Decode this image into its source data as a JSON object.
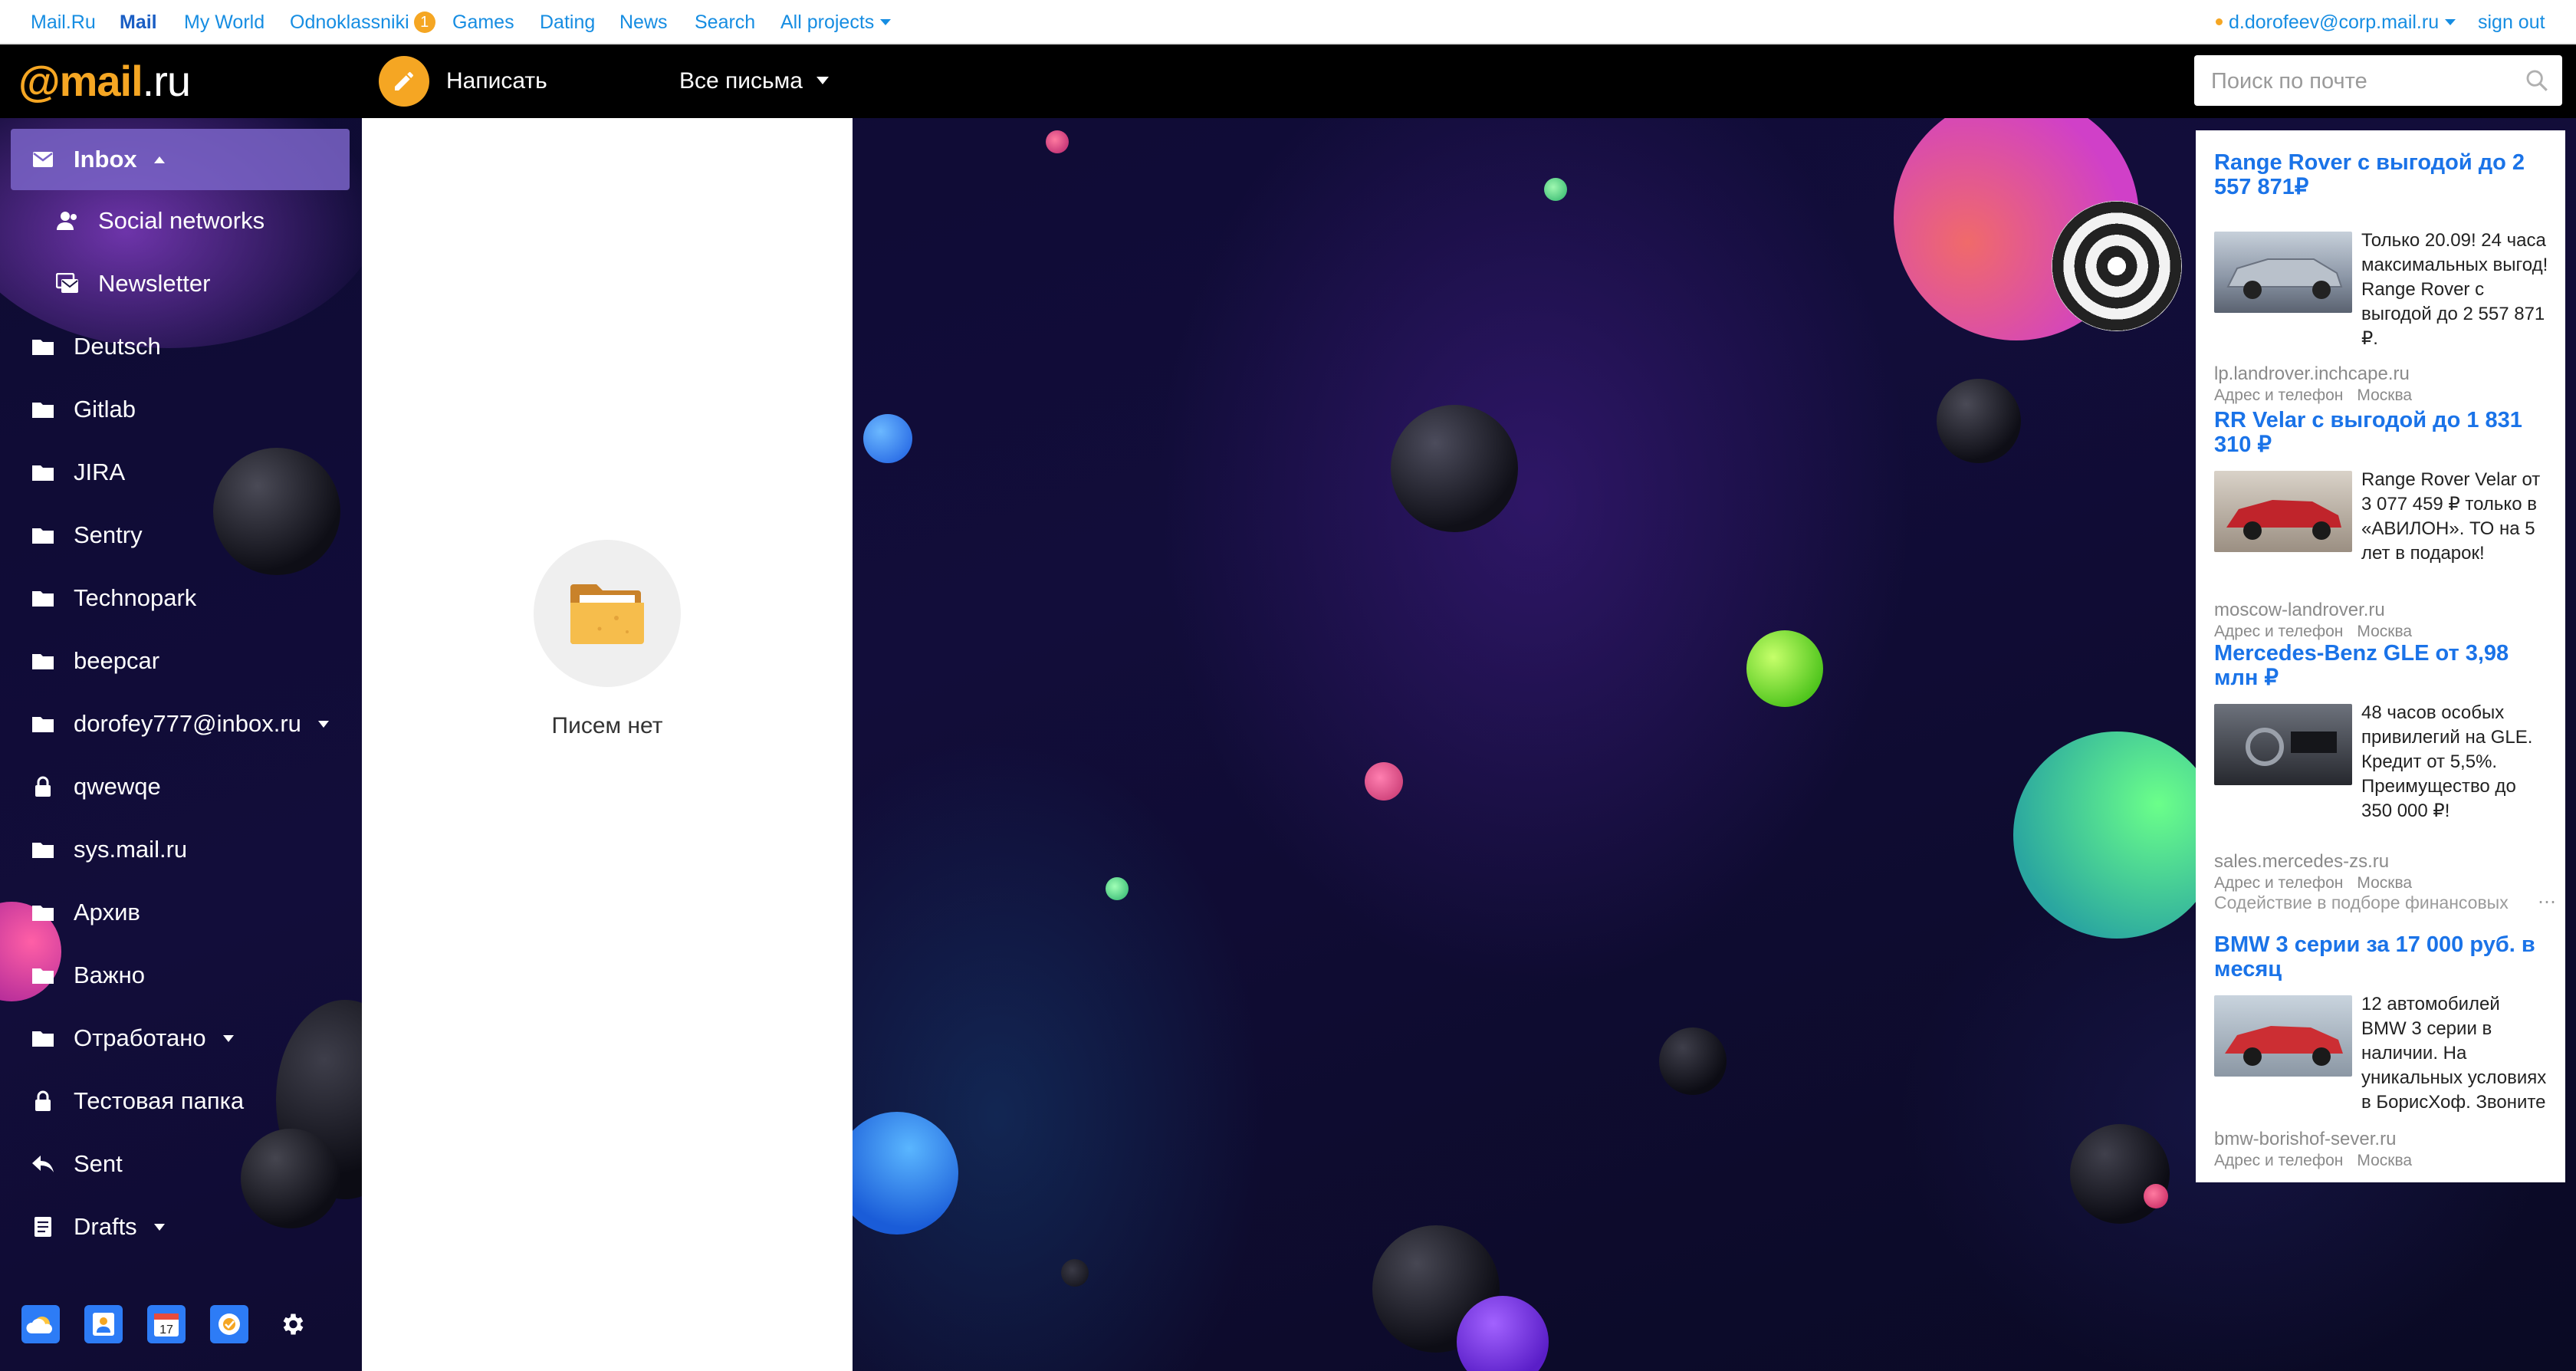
{
  "portal": {
    "links": [
      "Mail.Ru",
      "Mail",
      "My World",
      "Odnoklassniki",
      "Games",
      "Dating",
      "News",
      "Search",
      "All projects"
    ],
    "odnoklassniki_badge": "1",
    "user_email": "d.dorofeev@corp.mail.ru",
    "sign_out": "sign out"
  },
  "header": {
    "logo_at": "@",
    "logo_mail": "mail",
    "logo_ru": ".ru",
    "compose_label": "Написать",
    "filter_label": "Все письма",
    "search_placeholder": "Поиск по почте"
  },
  "sidebar": {
    "folders": [
      {
        "label": "Inbox",
        "icon": "inbox-icon"
      },
      {
        "label": "Social networks",
        "icon": "social-icon"
      },
      {
        "label": "Newsletter",
        "icon": "newsletter-icon"
      },
      {
        "label": "Deutsch",
        "icon": "folder-icon"
      },
      {
        "label": "Gitlab",
        "icon": "folder-icon"
      },
      {
        "label": "JIRA",
        "icon": "folder-icon"
      },
      {
        "label": "Sentry",
        "icon": "folder-icon"
      },
      {
        "label": "Technopark",
        "icon": "folder-icon"
      },
      {
        "label": "beepcar",
        "icon": "folder-icon"
      },
      {
        "label": "dorofey777@inbox.ru",
        "icon": "folder-icon"
      },
      {
        "label": "qwewqe",
        "icon": "lock-icon"
      },
      {
        "label": "sys.mail.ru",
        "icon": "folder-icon"
      },
      {
        "label": "Архив",
        "icon": "folder-icon"
      },
      {
        "label": "Важно",
        "icon": "folder-icon"
      },
      {
        "label": "Отработано",
        "icon": "folder-icon"
      },
      {
        "label": "Тестовая папка",
        "icon": "lock-icon"
      },
      {
        "label": "Sent",
        "icon": "sent-icon"
      },
      {
        "label": "Drafts",
        "icon": "drafts-icon"
      }
    ],
    "apps": [
      "cloud-icon",
      "contacts-icon",
      "calendar-icon",
      "todo-icon",
      "settings-icon"
    ],
    "calendar_day": "17"
  },
  "list": {
    "empty_text": "Писем нет"
  },
  "ads": {
    "items": [
      {
        "title": "Range Rover с выгодой до 2 557 871₽",
        "desc": "Только 20.09! 24 часа максимальных выгод! Range Rover с выгодой до 2 557 871 ₽.",
        "url": "lp.landrover.inchcape.ru",
        "meta_contacts": "Адрес и телефон",
        "meta_city": "Москва",
        "img_color": "#9aa6b6"
      },
      {
        "title": "RR Velar с выгодой до 1 831 310 ₽",
        "desc": "Range Rover Velar от 3 077 459 ₽ только в «АВИЛОН». ТО на 5 лет в подарок!",
        "url": "moscow-landrover.ru",
        "meta_contacts": "Адрес и телефон",
        "meta_city": "Москва",
        "img_color": "#b32a2a"
      },
      {
        "title": "Mercedes-Benz GLE от 3,98 млн ₽",
        "desc": "48 часов особых привилегий на GLE. Кредит от 5,5%. Преимущество до 350 000 ₽!",
        "url": "sales.mercedes-zs.ru",
        "meta_contacts": "Адрес и телефон",
        "meta_city": "Москва",
        "img_color": "#3a3c44"
      },
      {
        "title": "BMW 3 серии за 17 000 руб. в месяц",
        "desc": "12 автомобилей BMW 3 серии в наличии. На уникальных условиях в БорисХоф. Звоните",
        "url": "bmw-borishof-sever.ru",
        "meta_contacts": "Адрес и телефон",
        "meta_city": "Москва",
        "img_color": "#c0353a"
      }
    ],
    "note": "Содействие в подборе финансовых"
  },
  "colors": {
    "accent": "#f5a623",
    "link": "#168de2",
    "ad_title": "#1a73e8",
    "sidebar_active": "#7a64c8"
  }
}
